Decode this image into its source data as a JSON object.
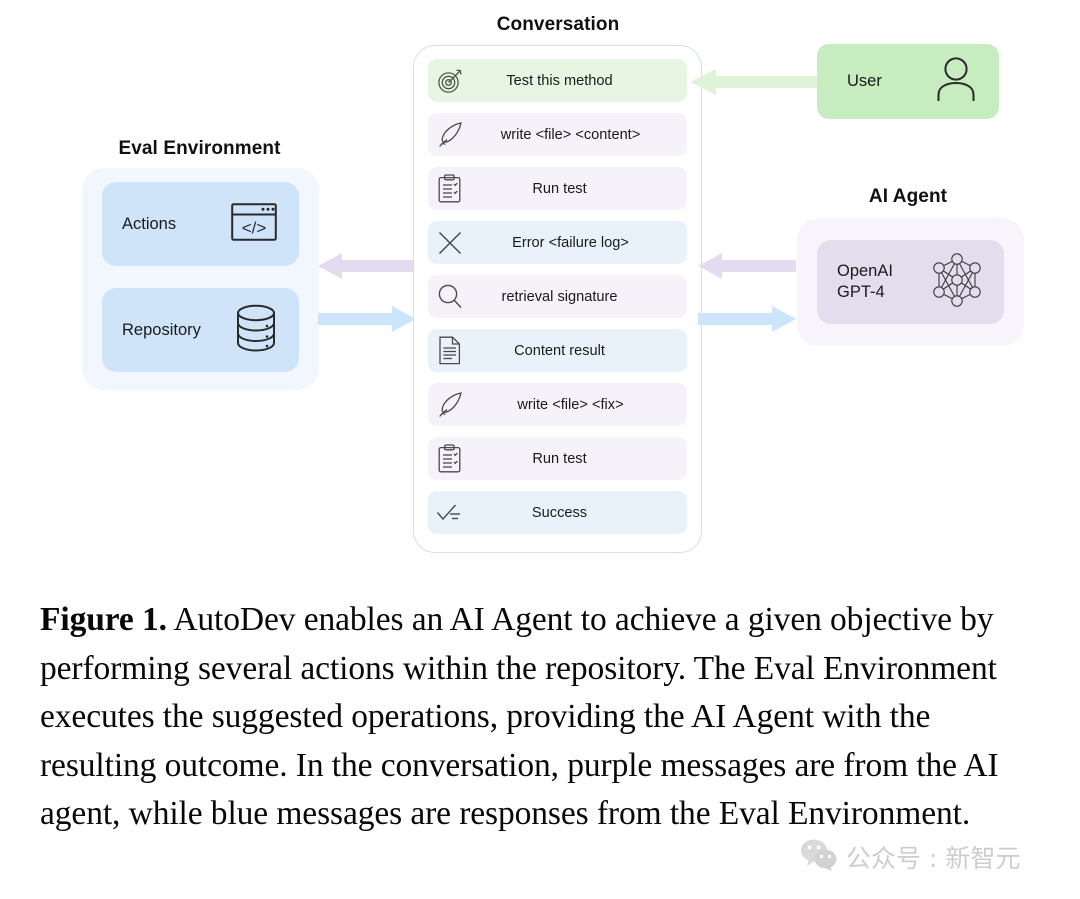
{
  "figure": {
    "caption_label": "Figure 1.",
    "caption_text": " AutoDev enables an AI Agent to achieve a given objective by performing several actions within the repository. The Eval Environment executes the suggested operations, providing the AI Agent with the resulting outcome. In the conversation, purple messages are from the AI agent, while blue messages are responses from the Eval Environment."
  },
  "eval_environment": {
    "title": "Eval Environment",
    "cards": [
      {
        "label": "Actions",
        "icon": "code-window-icon"
      },
      {
        "label": "Repository",
        "icon": "database-icon"
      }
    ]
  },
  "conversation": {
    "title": "Conversation",
    "messages": [
      {
        "text": "Test this method",
        "icon": "target-icon",
        "source": "user"
      },
      {
        "text": "write <file> <content>",
        "icon": "quill-pen-icon",
        "source": "agent"
      },
      {
        "text": "Run test",
        "icon": "clipboard-icon",
        "source": "agent"
      },
      {
        "text": "Error <failure log>",
        "icon": "cross-icon",
        "source": "eval"
      },
      {
        "text": "retrieval signature",
        "icon": "magnifier-icon",
        "source": "agent"
      },
      {
        "text": "Content result",
        "icon": "document-icon",
        "source": "eval"
      },
      {
        "text": "write <file> <fix>",
        "icon": "quill-pen-icon",
        "source": "agent"
      },
      {
        "text": "Run test",
        "icon": "clipboard-icon",
        "source": "agent"
      },
      {
        "text": "Success",
        "icon": "checklist-icon",
        "source": "eval"
      }
    ]
  },
  "ai_agent": {
    "title": "AI Agent",
    "card": {
      "line1": "OpenAI",
      "line2": "GPT-4",
      "icon": "neural-network-icon"
    }
  },
  "user": {
    "label": "User",
    "icon": "person-icon"
  },
  "watermark": {
    "text": "公众号 : 新智元",
    "icon": "wechat-icon"
  },
  "colors": {
    "user_green": "#c6ecbf",
    "agent_purple": "#e3ddee",
    "eval_blue": "#cfe4f9",
    "msg_user_bg": "#e7f5e3",
    "msg_agent_bg": "#f6f2f9",
    "msg_eval_bg": "#e9f2fb",
    "arrow_purple": "#e3dcf0",
    "arrow_blue": "#cde5fa",
    "arrow_green": "#dff3d9"
  }
}
